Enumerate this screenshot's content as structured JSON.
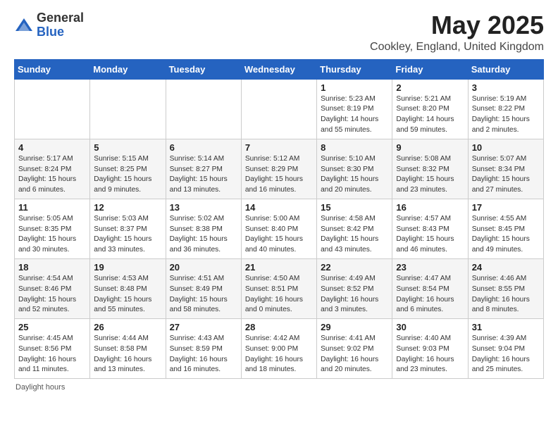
{
  "logo": {
    "general": "General",
    "blue": "Blue"
  },
  "title": "May 2025",
  "location": "Cookley, England, United Kingdom",
  "weekdays": [
    "Sunday",
    "Monday",
    "Tuesday",
    "Wednesday",
    "Thursday",
    "Friday",
    "Saturday"
  ],
  "weeks": [
    [
      {
        "day": "",
        "info": ""
      },
      {
        "day": "",
        "info": ""
      },
      {
        "day": "",
        "info": ""
      },
      {
        "day": "",
        "info": ""
      },
      {
        "day": "1",
        "info": "Sunrise: 5:23 AM\nSunset: 8:19 PM\nDaylight: 14 hours\nand 55 minutes."
      },
      {
        "day": "2",
        "info": "Sunrise: 5:21 AM\nSunset: 8:20 PM\nDaylight: 14 hours\nand 59 minutes."
      },
      {
        "day": "3",
        "info": "Sunrise: 5:19 AM\nSunset: 8:22 PM\nDaylight: 15 hours\nand 2 minutes."
      }
    ],
    [
      {
        "day": "4",
        "info": "Sunrise: 5:17 AM\nSunset: 8:24 PM\nDaylight: 15 hours\nand 6 minutes."
      },
      {
        "day": "5",
        "info": "Sunrise: 5:15 AM\nSunset: 8:25 PM\nDaylight: 15 hours\nand 9 minutes."
      },
      {
        "day": "6",
        "info": "Sunrise: 5:14 AM\nSunset: 8:27 PM\nDaylight: 15 hours\nand 13 minutes."
      },
      {
        "day": "7",
        "info": "Sunrise: 5:12 AM\nSunset: 8:29 PM\nDaylight: 15 hours\nand 16 minutes."
      },
      {
        "day": "8",
        "info": "Sunrise: 5:10 AM\nSunset: 8:30 PM\nDaylight: 15 hours\nand 20 minutes."
      },
      {
        "day": "9",
        "info": "Sunrise: 5:08 AM\nSunset: 8:32 PM\nDaylight: 15 hours\nand 23 minutes."
      },
      {
        "day": "10",
        "info": "Sunrise: 5:07 AM\nSunset: 8:34 PM\nDaylight: 15 hours\nand 27 minutes."
      }
    ],
    [
      {
        "day": "11",
        "info": "Sunrise: 5:05 AM\nSunset: 8:35 PM\nDaylight: 15 hours\nand 30 minutes."
      },
      {
        "day": "12",
        "info": "Sunrise: 5:03 AM\nSunset: 8:37 PM\nDaylight: 15 hours\nand 33 minutes."
      },
      {
        "day": "13",
        "info": "Sunrise: 5:02 AM\nSunset: 8:38 PM\nDaylight: 15 hours\nand 36 minutes."
      },
      {
        "day": "14",
        "info": "Sunrise: 5:00 AM\nSunset: 8:40 PM\nDaylight: 15 hours\nand 40 minutes."
      },
      {
        "day": "15",
        "info": "Sunrise: 4:58 AM\nSunset: 8:42 PM\nDaylight: 15 hours\nand 43 minutes."
      },
      {
        "day": "16",
        "info": "Sunrise: 4:57 AM\nSunset: 8:43 PM\nDaylight: 15 hours\nand 46 minutes."
      },
      {
        "day": "17",
        "info": "Sunrise: 4:55 AM\nSunset: 8:45 PM\nDaylight: 15 hours\nand 49 minutes."
      }
    ],
    [
      {
        "day": "18",
        "info": "Sunrise: 4:54 AM\nSunset: 8:46 PM\nDaylight: 15 hours\nand 52 minutes."
      },
      {
        "day": "19",
        "info": "Sunrise: 4:53 AM\nSunset: 8:48 PM\nDaylight: 15 hours\nand 55 minutes."
      },
      {
        "day": "20",
        "info": "Sunrise: 4:51 AM\nSunset: 8:49 PM\nDaylight: 15 hours\nand 58 minutes."
      },
      {
        "day": "21",
        "info": "Sunrise: 4:50 AM\nSunset: 8:51 PM\nDaylight: 16 hours\nand 0 minutes."
      },
      {
        "day": "22",
        "info": "Sunrise: 4:49 AM\nSunset: 8:52 PM\nDaylight: 16 hours\nand 3 minutes."
      },
      {
        "day": "23",
        "info": "Sunrise: 4:47 AM\nSunset: 8:54 PM\nDaylight: 16 hours\nand 6 minutes."
      },
      {
        "day": "24",
        "info": "Sunrise: 4:46 AM\nSunset: 8:55 PM\nDaylight: 16 hours\nand 8 minutes."
      }
    ],
    [
      {
        "day": "25",
        "info": "Sunrise: 4:45 AM\nSunset: 8:56 PM\nDaylight: 16 hours\nand 11 minutes."
      },
      {
        "day": "26",
        "info": "Sunrise: 4:44 AM\nSunset: 8:58 PM\nDaylight: 16 hours\nand 13 minutes."
      },
      {
        "day": "27",
        "info": "Sunrise: 4:43 AM\nSunset: 8:59 PM\nDaylight: 16 hours\nand 16 minutes."
      },
      {
        "day": "28",
        "info": "Sunrise: 4:42 AM\nSunset: 9:00 PM\nDaylight: 16 hours\nand 18 minutes."
      },
      {
        "day": "29",
        "info": "Sunrise: 4:41 AM\nSunset: 9:02 PM\nDaylight: 16 hours\nand 20 minutes."
      },
      {
        "day": "30",
        "info": "Sunrise: 4:40 AM\nSunset: 9:03 PM\nDaylight: 16 hours\nand 23 minutes."
      },
      {
        "day": "31",
        "info": "Sunrise: 4:39 AM\nSunset: 9:04 PM\nDaylight: 16 hours\nand 25 minutes."
      }
    ]
  ],
  "footer": "Daylight hours"
}
